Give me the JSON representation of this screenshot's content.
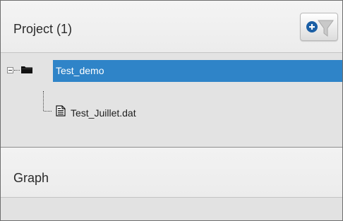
{
  "project_panel": {
    "title": "Project (1)",
    "filter_button": {
      "icons": [
        "add-circle-icon",
        "funnel-icon"
      ]
    }
  },
  "tree": {
    "root": {
      "label": "Test_demo",
      "expanded": true,
      "selected": true,
      "icon": "folder-icon"
    },
    "children": [
      {
        "label": "Test_Juillet.dat",
        "icon": "file-icon"
      }
    ]
  },
  "graph_panel": {
    "title": "Graph"
  },
  "colors": {
    "selection": "#2f84c8",
    "add_icon": "#1b5fa5",
    "panel_bg": "#e2e2e2"
  }
}
